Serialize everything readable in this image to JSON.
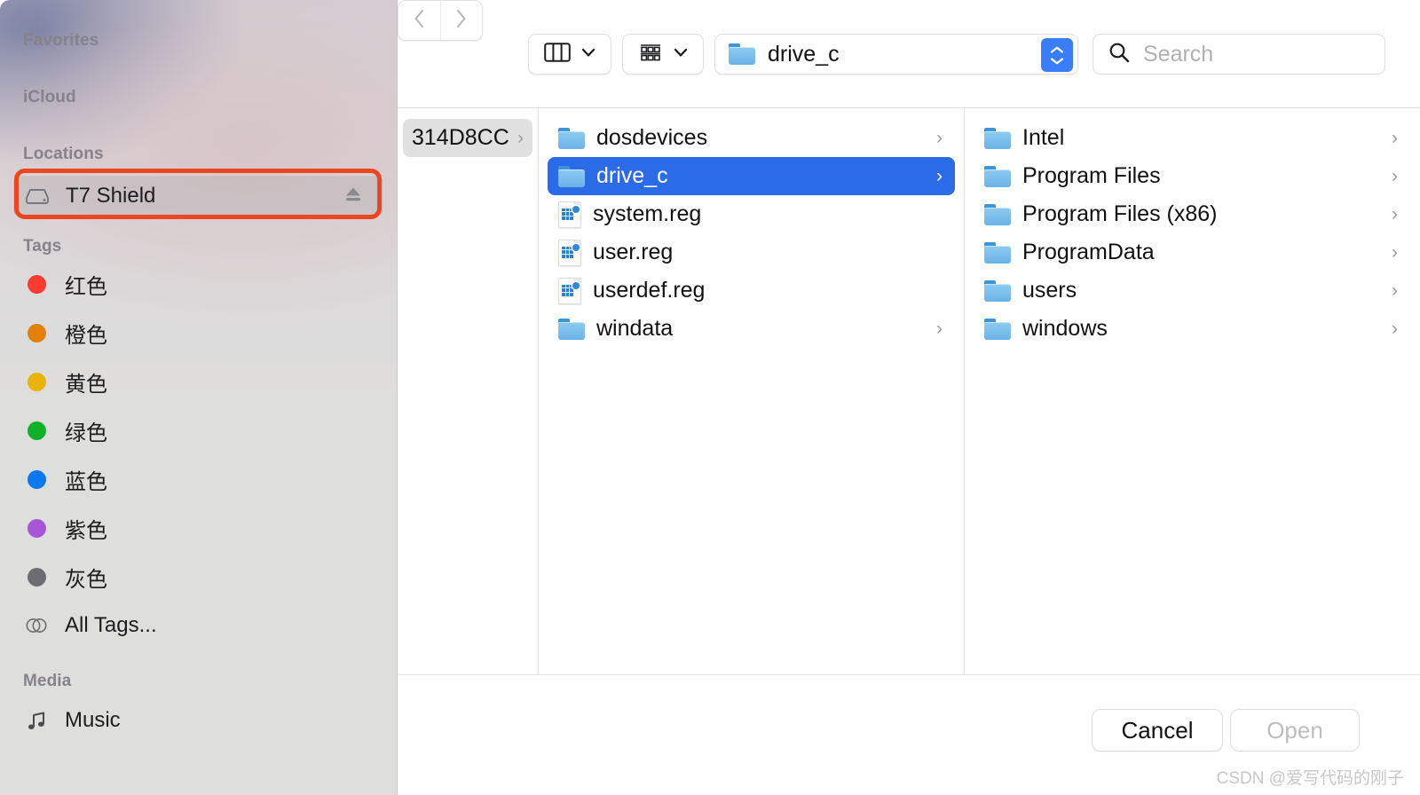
{
  "sidebar": {
    "sections": [
      {
        "title": "Favorites",
        "items": []
      },
      {
        "title": "iCloud",
        "items": []
      },
      {
        "title": "Locations",
        "items": [
          {
            "label": "T7 Shield",
            "icon": "external-drive-icon",
            "eject": true,
            "highlighted": true
          }
        ]
      },
      {
        "title": "Tags",
        "items": [
          {
            "label": "红色",
            "color": "#fb3b30"
          },
          {
            "label": "橙色",
            "color": "#e2800a"
          },
          {
            "label": "黄色",
            "color": "#eab308"
          },
          {
            "label": "绿色",
            "color": "#0fb129"
          },
          {
            "label": "蓝色",
            "color": "#0a78f0"
          },
          {
            "label": "紫色",
            "color": "#a855d8"
          },
          {
            "label": "灰色",
            "color": "#6c6c72"
          }
        ]
      },
      {
        "title": "Media",
        "items": [
          {
            "label": "Music",
            "icon": "music-note-icon"
          }
        ]
      }
    ],
    "all_tags_label": "All Tags...",
    "annotation_color": "#ec4620"
  },
  "toolbar": {
    "back_icon": "chevron-left-icon",
    "forward_icon": "chevron-right-icon",
    "view_icon": "column-view-icon",
    "group_icon": "group-by-icon",
    "dropdown_icon": "chevron-down-icon",
    "path": {
      "label": "drive_c",
      "icon": "folder-icon"
    },
    "stepper_color": "#3a7dfa",
    "search": {
      "placeholder": "Search",
      "icon": "search-icon"
    }
  },
  "columns": [
    {
      "name": "column-1",
      "items": [
        {
          "label": "314D8CC",
          "type": "breadcrumb",
          "chevron": true
        }
      ]
    },
    {
      "name": "column-2",
      "items": [
        {
          "label": "dosdevices",
          "type": "folder",
          "chevron": true,
          "selected": false
        },
        {
          "label": "drive_c",
          "type": "folder",
          "chevron": true,
          "selected": true
        },
        {
          "label": "system.reg",
          "type": "reg",
          "chevron": false,
          "selected": false
        },
        {
          "label": "user.reg",
          "type": "reg",
          "chevron": false,
          "selected": false
        },
        {
          "label": "userdef.reg",
          "type": "reg",
          "chevron": false,
          "selected": false
        },
        {
          "label": "windata",
          "type": "folder",
          "chevron": true,
          "selected": false
        }
      ]
    },
    {
      "name": "column-3",
      "items": [
        {
          "label": "Intel",
          "type": "folder",
          "chevron": true,
          "selected": false
        },
        {
          "label": "Program Files",
          "type": "folder",
          "chevron": true,
          "selected": false
        },
        {
          "label": "Program Files (x86)",
          "type": "folder",
          "chevron": true,
          "selected": false
        },
        {
          "label": "ProgramData",
          "type": "folder",
          "chevron": true,
          "selected": false
        },
        {
          "label": "users",
          "type": "folder",
          "chevron": true,
          "selected": false
        },
        {
          "label": "windows",
          "type": "folder",
          "chevron": true,
          "selected": false
        }
      ]
    }
  ],
  "footer": {
    "cancel_label": "Cancel",
    "open_label": "Open",
    "open_disabled": true
  },
  "watermark": "CSDN @爱写代码的刚子",
  "selection_color": "#2c6be8"
}
